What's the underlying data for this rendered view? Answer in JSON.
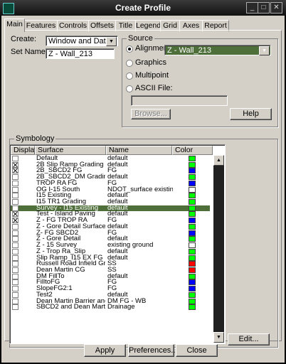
{
  "window": {
    "title": "Create Profile"
  },
  "tabs": [
    {
      "label": "Main"
    },
    {
      "label": "Features"
    },
    {
      "label": "Controls"
    },
    {
      "label": "Offsets"
    },
    {
      "label": "Title"
    },
    {
      "label": "Legend"
    },
    {
      "label": "Grid"
    },
    {
      "label": "Axes"
    },
    {
      "label": "Report"
    }
  ],
  "main": {
    "create_label": "Create:",
    "create_value": "Window and Data",
    "set_name_label": "Set Name:",
    "set_name_value": "Z - Wall_213"
  },
  "source": {
    "title": "Source",
    "alignment_label": "Alignment:",
    "alignment_value": "Z - Wall_213",
    "graphics_label": "Graphics",
    "multipoint_label": "Multipoint",
    "ascii_label": "ASCII File:",
    "ascii_value": "",
    "browse_label": "Browse...",
    "help_label": "Help",
    "selected": "alignment"
  },
  "symbology": {
    "title": "Symbology",
    "columns": [
      "Display",
      "Surface",
      "Name",
      "Color"
    ],
    "rows": [
      {
        "display": false,
        "surface": "Default",
        "name": "default",
        "color": "#00ff00"
      },
      {
        "display": true,
        "surface": "2B Slip Ramp Grading",
        "name": "default",
        "color": "#00ff00"
      },
      {
        "display": true,
        "surface": "2B_SBCD2 FG",
        "name": "FG",
        "color": "#0000ff"
      },
      {
        "display": false,
        "surface": "2B_SBCD2_DM Grading",
        "name": "default",
        "color": "#00ff00"
      },
      {
        "display": false,
        "surface": "TROP RA FG",
        "name": "FG",
        "color": "#0000ff"
      },
      {
        "display": false,
        "surface": "OG I-15 South",
        "name": "NDOT_surface existing",
        "color": "#ffffff"
      },
      {
        "display": false,
        "surface": "I15 Existing",
        "name": "default",
        "color": "#00ff00"
      },
      {
        "display": false,
        "surface": "I15 TR1 Grading",
        "name": "default",
        "color": "#00ff00"
      },
      {
        "display": false,
        "surface": "Survey - I15 Existing",
        "name": "default",
        "color": "#00ff00",
        "selected": true
      },
      {
        "display": true,
        "surface": "Test - Island Paving",
        "name": "default",
        "color": "#00ff00"
      },
      {
        "display": true,
        "surface": "Z - FG TROP RA",
        "name": "FG",
        "color": "#0000ff"
      },
      {
        "display": false,
        "surface": "Z - Gore Detail Surface FG",
        "name": "default",
        "color": "#00ff00"
      },
      {
        "display": false,
        "surface": "Z- FG SBCD2",
        "name": "FG",
        "color": "#0000ff"
      },
      {
        "display": false,
        "surface": "Z - Gore Detail",
        "name": "default",
        "color": "#00ff00"
      },
      {
        "display": false,
        "surface": "Z - 15 Survey",
        "name": "existing ground",
        "color": "#ffffff"
      },
      {
        "display": false,
        "surface": "Z - Trop Ra_Slip",
        "name": "default",
        "color": "#00ff00"
      },
      {
        "display": false,
        "surface": "Slip Ramp_I15 EX FG",
        "name": "default",
        "color": "#00ff00"
      },
      {
        "display": false,
        "surface": "Russell Road Infield Gradin",
        "name": "SS",
        "color": "#ff0000"
      },
      {
        "display": false,
        "surface": "Dean Martin CG",
        "name": "SS",
        "color": "#ff0000"
      },
      {
        "display": false,
        "surface": "DM FillTo",
        "name": "default",
        "color": "#00ff00"
      },
      {
        "display": false,
        "surface": "FilltoFG",
        "name": "FG",
        "color": "#0000ff"
      },
      {
        "display": false,
        "surface": "SlopeFG2:1",
        "name": "FG",
        "color": "#0000ff"
      },
      {
        "display": false,
        "surface": "Test2",
        "name": "default",
        "color": "#00ff00"
      },
      {
        "display": false,
        "surface": "Dean Martin Barrier and Ca",
        "name": "DM FG - WB",
        "color": "#00ff00"
      },
      {
        "display": false,
        "surface": "SBCD2 and Dean Martin G",
        "name": "Drainage",
        "color": "#00ff00"
      }
    ],
    "edit_label": "Edit..."
  },
  "footer": {
    "apply_label": "Apply",
    "preferences_label": "Preferences...",
    "close_label": "Close"
  }
}
